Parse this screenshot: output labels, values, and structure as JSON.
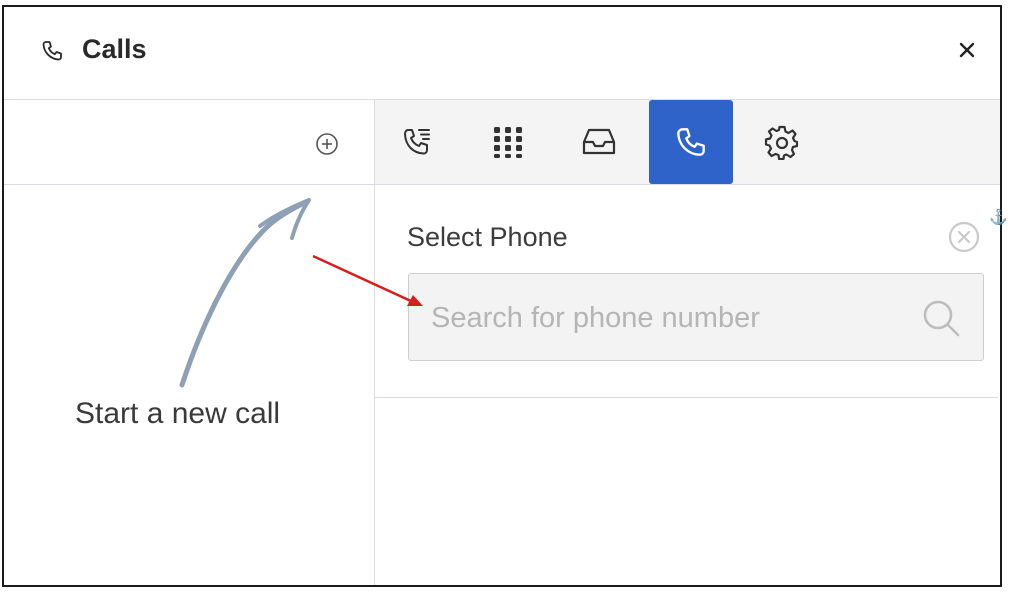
{
  "header": {
    "title": "Calls",
    "title_icon": "phone-icon",
    "close_icon": "close-icon"
  },
  "left_panel": {
    "add_icon": "plus-circle-icon",
    "hint_text": "Start a new call"
  },
  "tabs": [
    {
      "name": "call-log",
      "icon": "call-log-icon",
      "active": false
    },
    {
      "name": "dialpad",
      "icon": "dialpad-icon",
      "active": false
    },
    {
      "name": "inbox",
      "icon": "inbox-icon",
      "active": false
    },
    {
      "name": "phone",
      "icon": "phone-icon",
      "active": true
    },
    {
      "name": "settings",
      "icon": "gear-icon",
      "active": false
    }
  ],
  "phone_panel": {
    "label": "Select Phone",
    "search_placeholder": "Search for phone number",
    "clear_icon": "clear-circle-icon",
    "search_icon": "search-icon"
  },
  "colors": {
    "accent": "#2f63c9",
    "annotation_arrow": "#d81d1d",
    "hand_arrow": "#8fa0b5"
  }
}
